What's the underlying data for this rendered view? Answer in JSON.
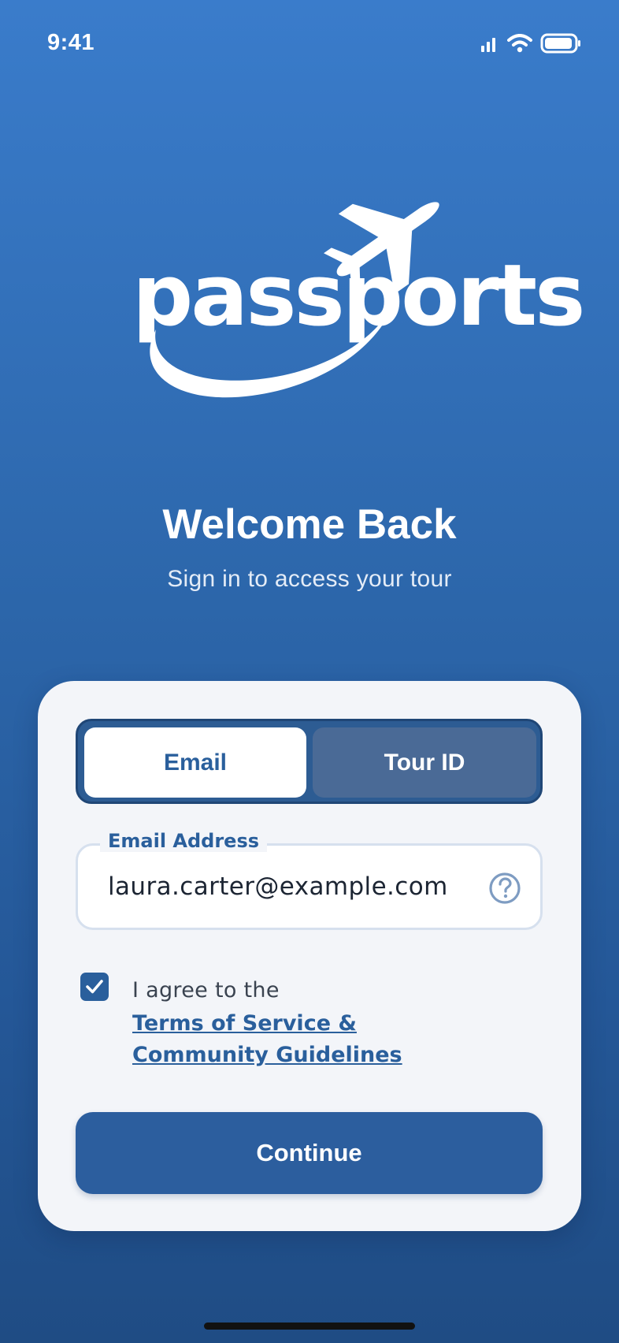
{
  "status_bar": {
    "time": "9:41",
    "icons": [
      "signal-icon",
      "wifi-icon",
      "battery-icon"
    ]
  },
  "logo": {
    "wordmark": "passports",
    "icon": "airplane-icon"
  },
  "welcome": {
    "title": "Welcome Back",
    "subtitle": "Sign in to access your tour"
  },
  "login_card": {
    "tabs": [
      {
        "label": "Email",
        "selected": true
      },
      {
        "label": "Tour ID",
        "selected": false
      }
    ],
    "email_field": {
      "label": "Email Address",
      "value": "laura.carter@example.com",
      "help_icon": "question-circle-icon"
    },
    "agreement": {
      "checked": true,
      "prefix": "I agree to the",
      "link_text": "Terms of Service & Community Guidelines"
    },
    "continue_label": "Continue"
  },
  "colors": {
    "background_top": "#3a7ccb",
    "background_bottom": "#1f4c84",
    "accent": "#2a5f9c",
    "card": "#f3f5f9"
  }
}
